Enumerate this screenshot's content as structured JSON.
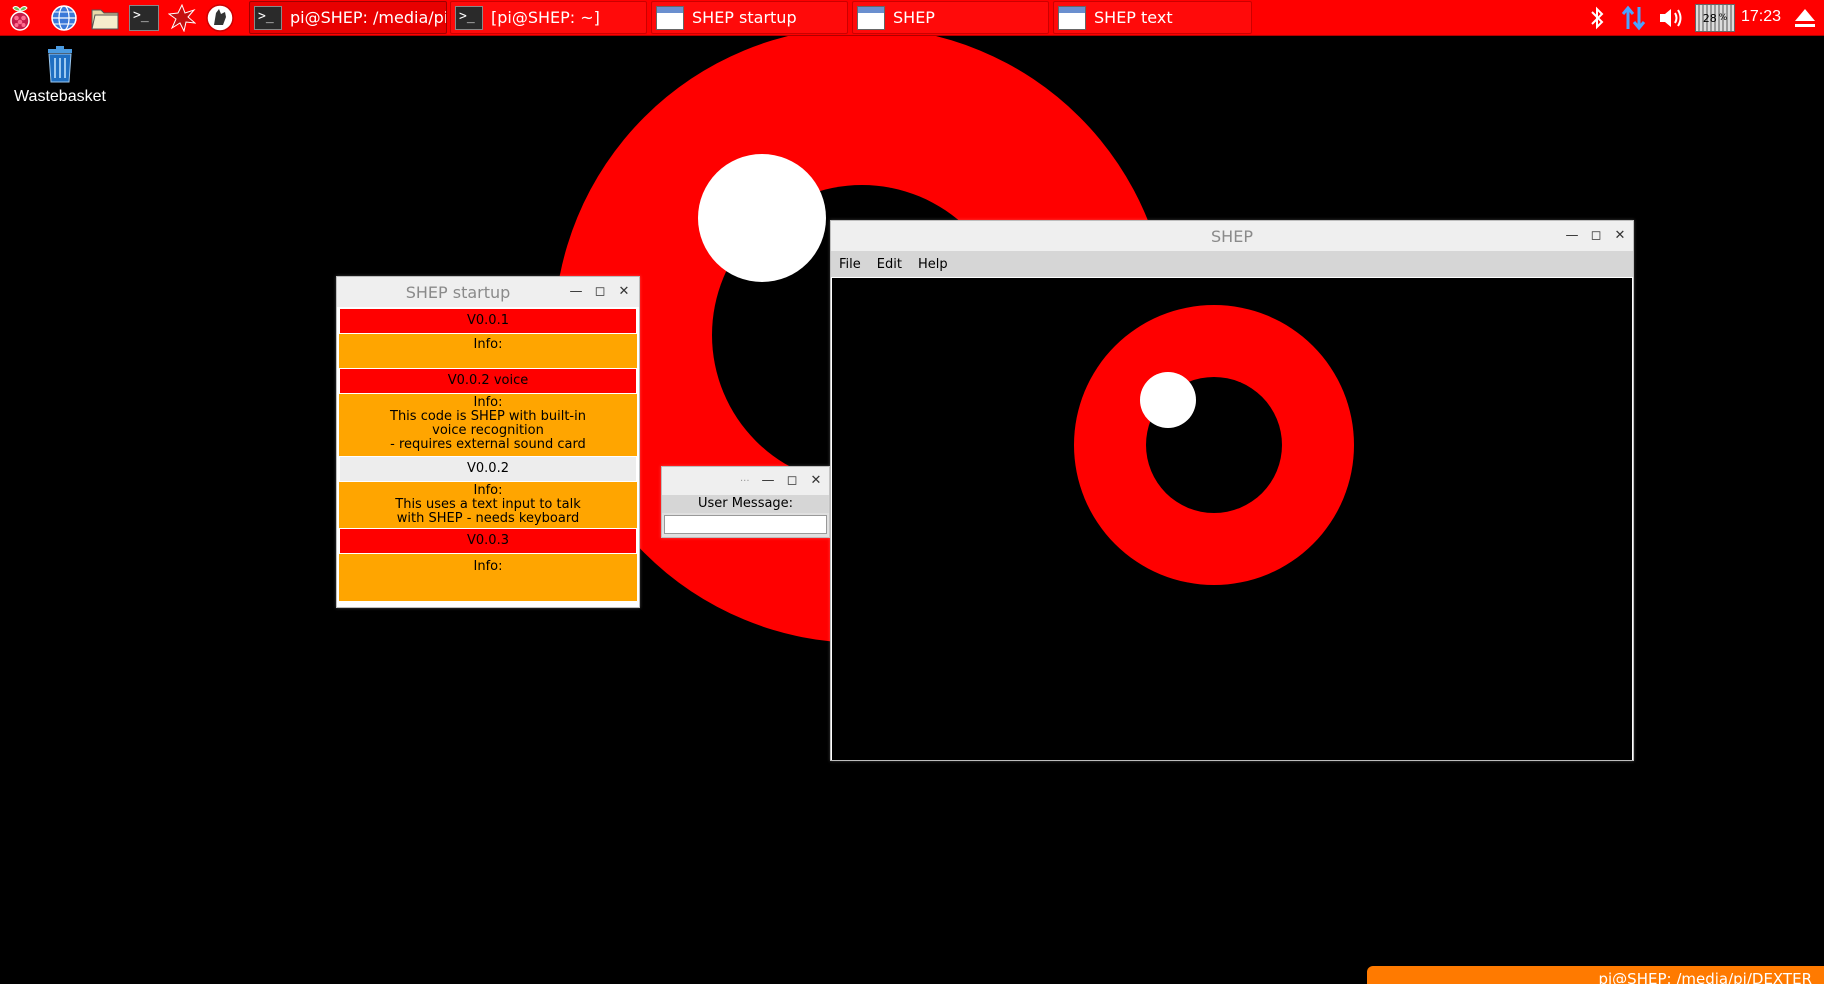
{
  "taskbar": {
    "launchers": [
      "raspberry-menu-icon",
      "web-browser-icon",
      "file-manager-icon",
      "terminal-icon",
      "mathematica-icon",
      "wolfram-icon"
    ],
    "tasks": [
      {
        "label": "pi@SHEP: /media/pi...",
        "icon": "terminal-icon"
      },
      {
        "label": "[pi@SHEP: ~]",
        "icon": "terminal-icon"
      },
      {
        "label": "SHEP startup",
        "icon": "window-icon"
      },
      {
        "label": "SHEP",
        "icon": "window-icon"
      },
      {
        "label": "SHEP text",
        "icon": "window-icon"
      }
    ],
    "cpu_percent": "28",
    "cpu_unit": "%",
    "clock": "17:23"
  },
  "desktop": {
    "wastebasket_label": "Wastebasket",
    "notification_text": "pi@SHEP: /media/pi/DEXTER"
  },
  "startup_window": {
    "title": "SHEP startup",
    "entries": [
      {
        "version": "V0.0.1",
        "info": "Info:",
        "style": "red"
      },
      {
        "version": "V0.0.2 voice",
        "info": "Info:\nThis code is SHEP with built-in\nvoice recognition\n- requires external sound card",
        "style": "red"
      },
      {
        "version": "V0.0.2",
        "info": "Info:\nThis uses a text input to talk\nwith SHEP - needs keyboard",
        "style": "grey"
      },
      {
        "version": "V0.0.3",
        "info": "Info:",
        "style": "red"
      }
    ]
  },
  "text_window": {
    "title": "...",
    "label": "User Message:",
    "input_value": ""
  },
  "shep_window": {
    "title": "SHEP",
    "menu": [
      "File",
      "Edit",
      "Help"
    ]
  },
  "colors": {
    "accent": "#ff0000",
    "info_bg": "#ffa500",
    "eye_red": "#ff0000",
    "pupil": "#000000",
    "highlight": "#ffffff"
  }
}
